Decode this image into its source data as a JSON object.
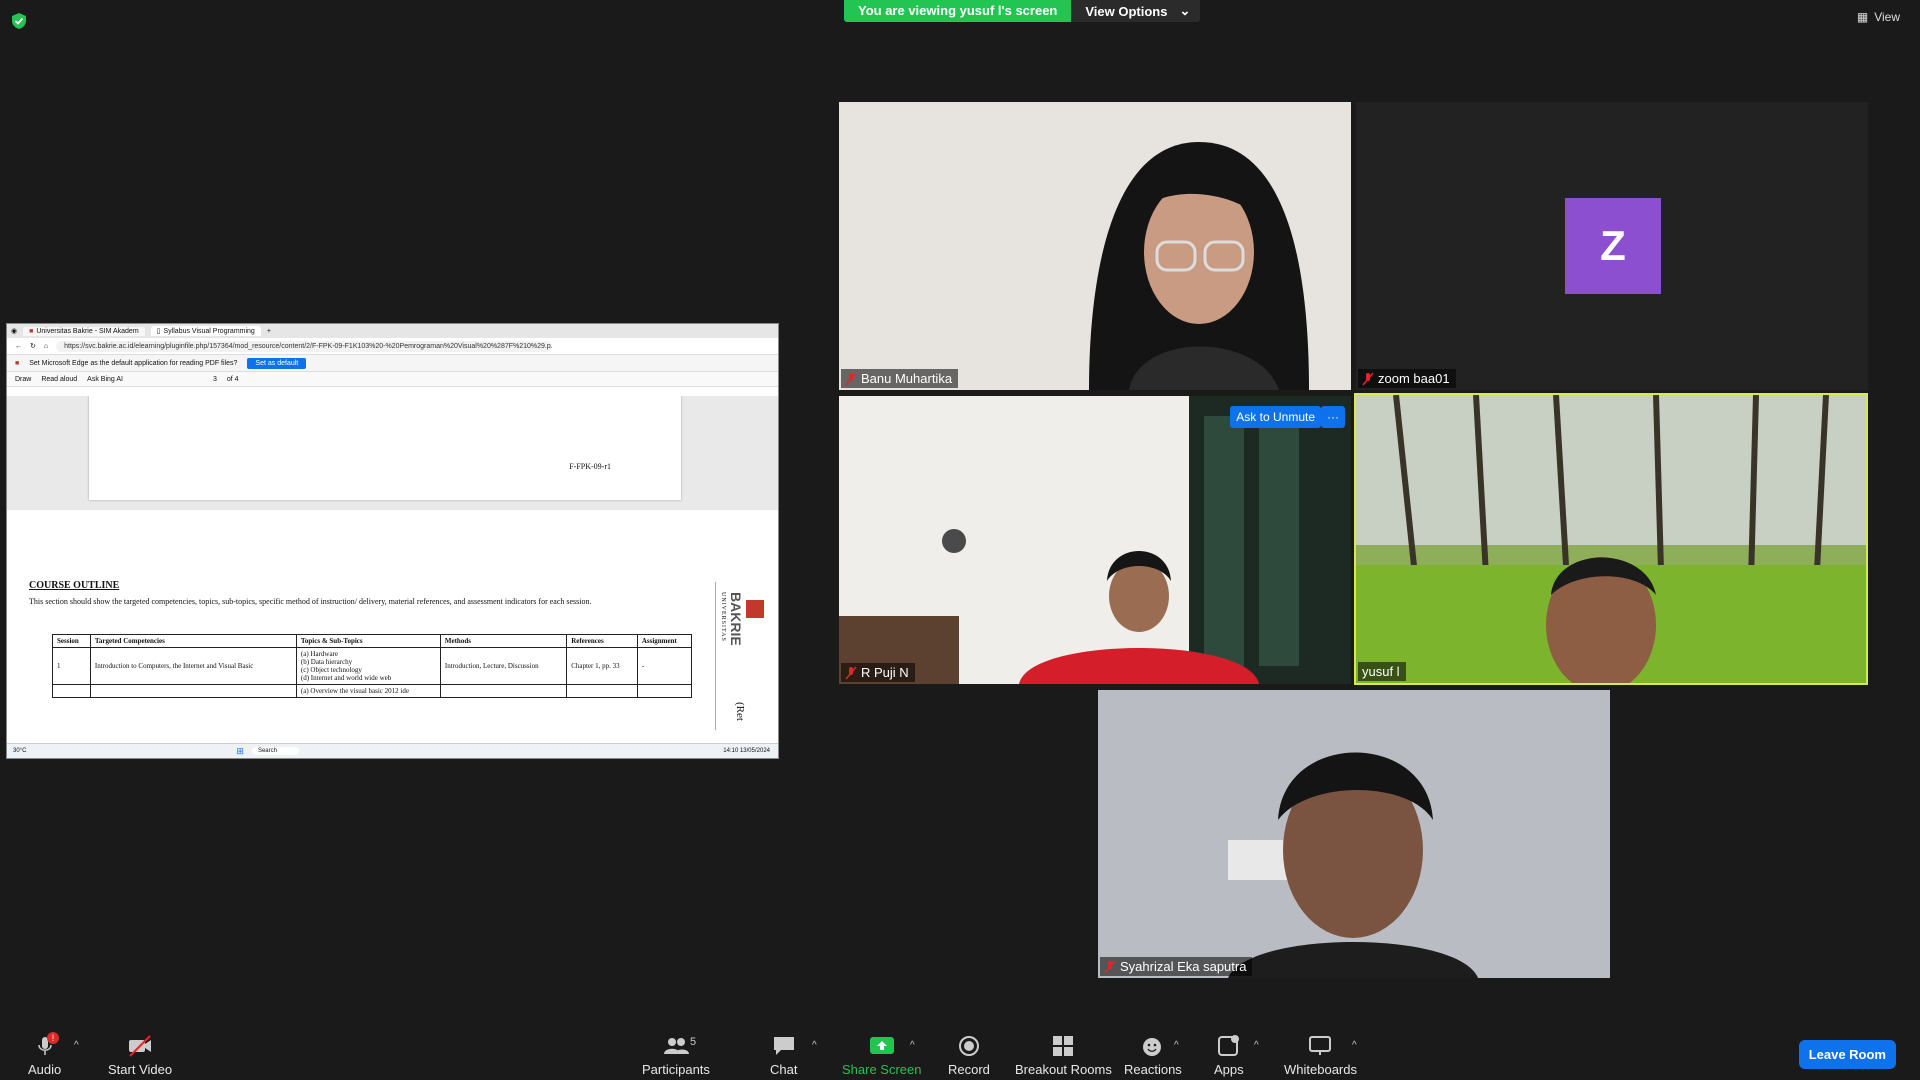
{
  "meeting": {
    "banner": "You are viewing yusuf l's screen",
    "view_options": "View Options",
    "view": "View"
  },
  "tiles": [
    {
      "name": "Banu Muhartika"
    },
    {
      "name": "zoom baa01",
      "initial": "Z"
    },
    {
      "name": "R Puji N",
      "ask_unmute": "Ask to Unmute",
      "more": "···"
    },
    {
      "name": "yusuf l"
    },
    {
      "name": "Syahrizal Eka saputra"
    }
  ],
  "shared_screen": {
    "tabs": [
      "Universitas Bakrie - SIM Akadem",
      "Syllabus Visual Programming"
    ],
    "url": "https://svc.bakrie.ac.id/elearning/pluginfile.php/157364/mod_resource/content/2/F-FPK-09-F1K103%20-%20Pemrograman%20Visual%20%287F%210%29.p...",
    "default_msg": "Set Microsoft Edge as the default application for reading PDF files?",
    "set_default": "Set as default",
    "pdf_tools": [
      "Draw",
      "Read aloud",
      "Ask Bing AI"
    ],
    "page_box": "3",
    "page_of": "of 4",
    "footer_code": "F-FPK-09-r1",
    "heading": "COURSE OUTLINE",
    "intro": "This section should show the targeted competencies, topics, sub-topics, specific method of instruction/ delivery, material references, and assessment indicators for each session.",
    "table_headers": [
      "Session",
      "Targeted Competencies",
      "Topics & Sub-Topics",
      "Methods",
      "References",
      "Assignment"
    ],
    "row1": {
      "session": "1",
      "competency": "Introduction to Computers, the Internet and Visual Basic",
      "topics": [
        "(a)  Hardware",
        "(b)  Data hierarchy",
        "(c)  Object technology",
        "(d)  Internet and world wide web"
      ],
      "methods": "Introduction, Lecture, Discussion",
      "references": "Chapter 1, pp. 33",
      "assignment": "-"
    },
    "row2_topic": "(a)  Overview the visual basic 2012 ide",
    "logo_univ": "UNIVERSITAS",
    "logo_name": "BAKRIE",
    "side_text": "(Ret",
    "taskbar_search": "Search",
    "weather": "30°C",
    "time": "14:10",
    "date": "13/05/2024"
  },
  "toolbar": {
    "audio": "Audio",
    "audio_badge": "!",
    "start_video": "Start Video",
    "participants": "Participants",
    "participants_count": "5",
    "chat": "Chat",
    "share_screen": "Share Screen",
    "record": "Record",
    "breakout": "Breakout Rooms",
    "reactions": "Reactions",
    "apps": "Apps",
    "whiteboards": "Whiteboards",
    "leave": "Leave Room"
  },
  "colors": {
    "share_green": "#23c552",
    "accent_blue": "#0e72ed",
    "avatar_purple": "#8c4fd0",
    "active_speaker": "#d9e84a"
  }
}
